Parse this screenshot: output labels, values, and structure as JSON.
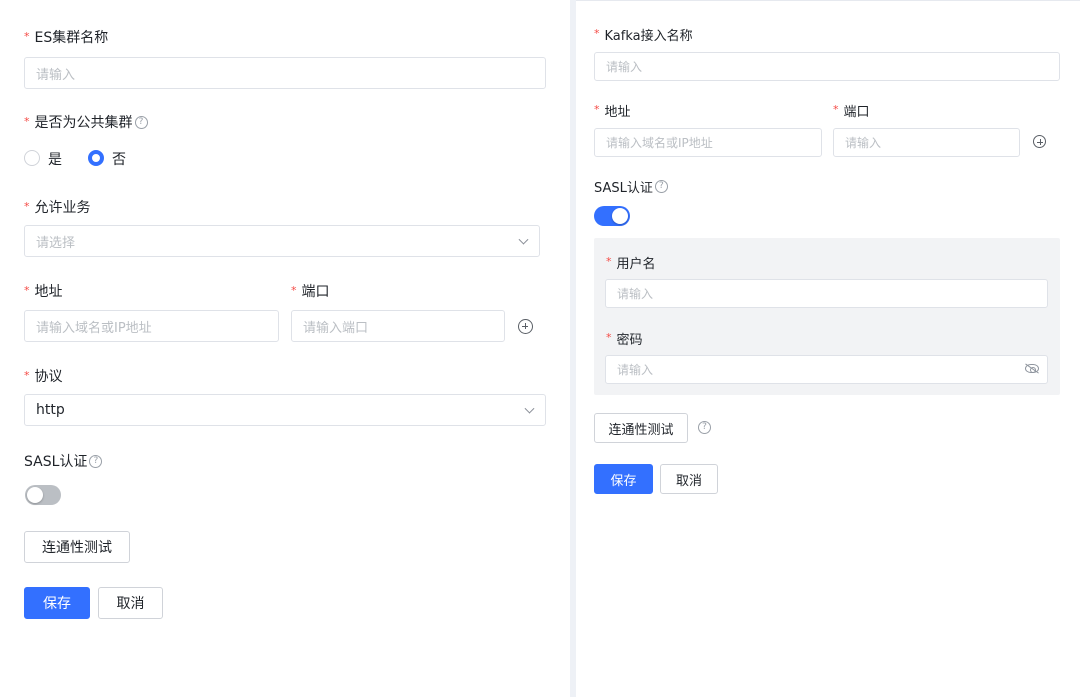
{
  "left_form": {
    "es_cluster_name": {
      "label": "ES集群名称",
      "placeholder": "请输入"
    },
    "is_public_cluster": {
      "label": "是否为公共集群",
      "options": [
        "是",
        "否"
      ],
      "selected": "否"
    },
    "allowed_business": {
      "label": "允许业务",
      "placeholder": "请选择"
    },
    "address": {
      "label": "地址",
      "placeholder": "请输入域名或IP地址"
    },
    "port": {
      "label": "端口",
      "placeholder": "请输入端口"
    },
    "protocol": {
      "label": "协议",
      "value": "http"
    },
    "sasl": {
      "label": "SASL认证",
      "enabled": false
    },
    "test_button": "连通性测试",
    "save_button": "保存",
    "cancel_button": "取消"
  },
  "right_form": {
    "kafka_name": {
      "label": "Kafka接入名称",
      "placeholder": "请输入"
    },
    "address": {
      "label": "地址",
      "placeholder": "请输入域名或IP地址"
    },
    "port": {
      "label": "端口",
      "placeholder": "请输入"
    },
    "sasl": {
      "label": "SASL认证",
      "enabled": true
    },
    "username": {
      "label": "用户名",
      "placeholder": "请输入"
    },
    "password": {
      "label": "密码",
      "placeholder": "请输入"
    },
    "test_button": "连通性测试",
    "save_button": "保存",
    "cancel_button": "取消"
  },
  "symbols": {
    "required": "*",
    "help": "?"
  },
  "colors": {
    "primary": "#3370ff",
    "required": "#f54a45",
    "toggle_off": "#bbbfc4",
    "sasl_box_bg": "#f2f3f5"
  }
}
